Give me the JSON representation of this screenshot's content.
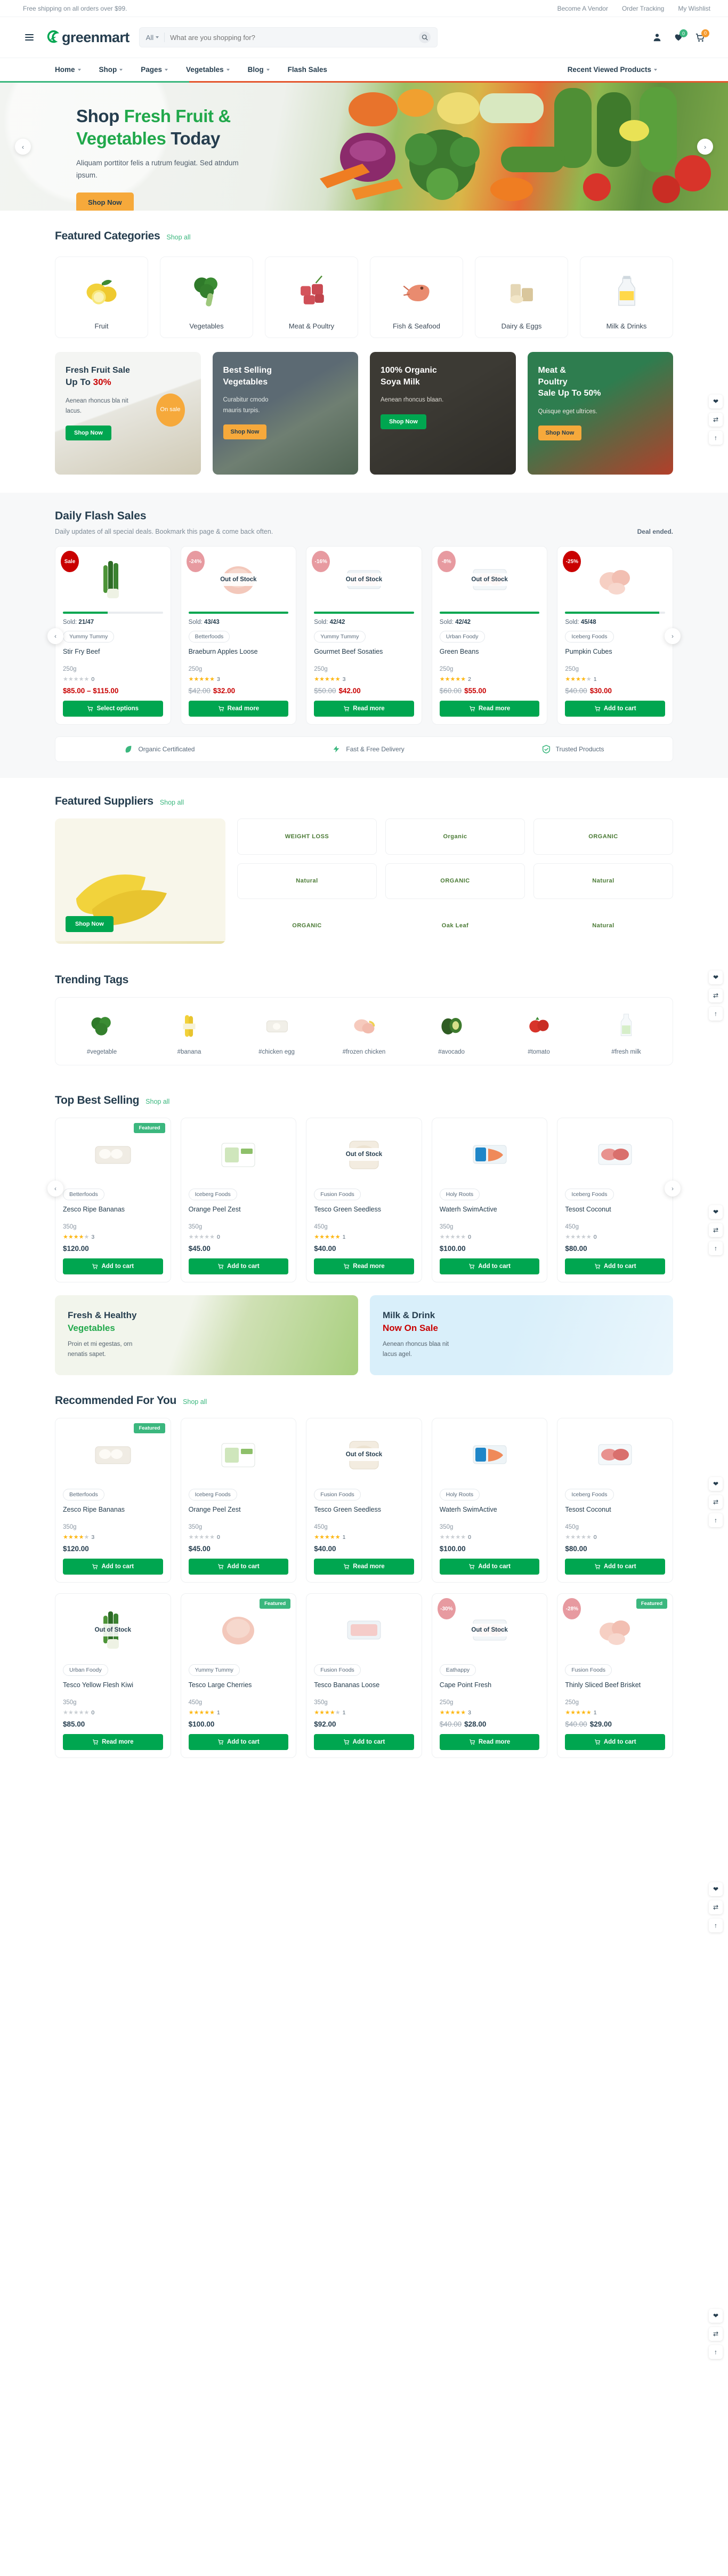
{
  "topbar": {
    "free_shipping": "Free shipping on all orders over $99.",
    "links": [
      "Become A Vendor",
      "Order Tracking",
      "My Wishlist"
    ]
  },
  "header": {
    "logo_text": "greenmart",
    "search": {
      "category": "All",
      "placeholder": "What are you shopping for?"
    },
    "cart_count": "0"
  },
  "nav": {
    "items": [
      {
        "label": "Home",
        "caret": true
      },
      {
        "label": "Shop",
        "caret": true
      },
      {
        "label": "Pages",
        "caret": true
      },
      {
        "label": "Vegetables",
        "caret": true
      },
      {
        "label": "Blog",
        "caret": true
      },
      {
        "label": "Flash Sales",
        "caret": false
      }
    ],
    "right": {
      "label": "Recent Viewed Products",
      "caret": true
    }
  },
  "hero": {
    "title_1": "Shop ",
    "title_green_1": "Fresh Fruit &",
    "title_green_2": "Vegetables",
    "title_2": " Today",
    "subtitle": "Aliquam porttitor felis a rutrum feugiat. Sed atndum ipsum.",
    "cta": "Shop Now",
    "prev": "‹",
    "next": "›"
  },
  "featured_categories": {
    "title": "Featured Categories",
    "shop_all": "Shop all",
    "items": [
      {
        "label": "Fruit",
        "icon": "lemon-icon"
      },
      {
        "label": "Vegetables",
        "icon": "broccoli-icon"
      },
      {
        "label": "Meat & Poultry",
        "icon": "meat-icon"
      },
      {
        "label": "Fish & Seafood",
        "icon": "shrimp-icon"
      },
      {
        "label": "Dairy & Eggs",
        "icon": "dairy-icon"
      },
      {
        "label": "Milk & Drinks",
        "icon": "milk-icon"
      }
    ]
  },
  "promos": [
    {
      "title_line1": "Fresh Fruit Sale",
      "title_line2": "Up To ",
      "highlight": "30%",
      "desc": "Aenean rhoncus bla nit lacus.",
      "cta": "Shop Now",
      "bubble": "On sale",
      "style": "p1",
      "btn": "green"
    },
    {
      "title_line1": "Best Selling",
      "title_line2": "Vegetables",
      "highlight": "",
      "desc": "Curabitur cmodo mauris turpis.",
      "cta": "Shop Now",
      "bubble": "",
      "style": "p2",
      "btn": "amber"
    },
    {
      "title_line1": "100% Organic",
      "title_line2": "Soya Milk",
      "highlight": "",
      "desc": "Aenean rhoncus blaan.",
      "cta": "Shop Now",
      "bubble": "",
      "style": "p3",
      "btn": "green"
    },
    {
      "title_line1": "Meat &",
      "title_line2": "Poultry",
      "title_line3": "Sale Up To",
      "highlight": "50%",
      "desc": "Quisque eget ultrices.",
      "cta": "Shop Now",
      "bubble": "",
      "style": "p4",
      "btn": "amber"
    }
  ],
  "flash_sales": {
    "title": "Daily Flash Sales",
    "subtitle": "Daily updates of all special deals. Bookmark this page & come back often.",
    "deal_status": "Deal ended.",
    "products": [
      {
        "badge": "Sale",
        "badge_type": "sale",
        "out_of_stock": false,
        "progress": 45,
        "sold": "Sold: ",
        "sold_val": "21/47",
        "vendor": "Yummy Tummy",
        "name": "Stir Fry Beef",
        "weight": "250g",
        "rating": 0,
        "rating_count": "0",
        "old_price": "",
        "price": "$85.00 – $115.00",
        "cta": "Select options"
      },
      {
        "badge": "-24%",
        "badge_type": "pct",
        "out_of_stock": true,
        "progress": 100,
        "sold": "Sold: ",
        "sold_val": "43/43",
        "vendor": "Betterfoods",
        "name": "Braeburn Apples Loose",
        "weight": "250g",
        "rating": 5,
        "rating_count": "3",
        "old_price": "$42.00",
        "price": "$32.00",
        "cta": "Read more"
      },
      {
        "badge": "-16%",
        "badge_type": "pct",
        "out_of_stock": true,
        "progress": 100,
        "sold": "Sold: ",
        "sold_val": "42/42",
        "vendor": "Yummy Tummy",
        "name": "Gourmet Beef Sosaties",
        "weight": "250g",
        "rating": 5,
        "rating_count": "3",
        "old_price": "$50.00",
        "price": "$42.00",
        "cta": "Read more"
      },
      {
        "badge": "-8%",
        "badge_type": "pct",
        "out_of_stock": true,
        "progress": 100,
        "sold": "Sold: ",
        "sold_val": "42/42",
        "vendor": "Urban Foody",
        "name": "Green Beans",
        "weight": "250g",
        "rating": 4.5,
        "rating_count": "2",
        "old_price": "$60.00",
        "price": "$55.00",
        "cta": "Read more"
      },
      {
        "badge": "-25%",
        "badge_type": "sale",
        "out_of_stock": false,
        "progress": 94,
        "sold": "Sold: ",
        "sold_val": "45/48",
        "vendor": "Iceberg Foods",
        "name": "Pumpkin Cubes",
        "weight": "250g",
        "rating": 4,
        "rating_count": "1",
        "old_price": "$40.00",
        "price": "$30.00",
        "cta": "Add to cart"
      }
    ],
    "trust": [
      {
        "label": "Organic Certificated",
        "icon": "leaf-icon"
      },
      {
        "label": "Fast & Free Delivery",
        "icon": "truck-icon"
      },
      {
        "label": "Trusted Products",
        "icon": "shield-icon"
      }
    ]
  },
  "suppliers": {
    "title": "Featured Suppliers",
    "shop_all": "Shop all",
    "banner_cta": "Shop Now",
    "logos": [
      "WEIGHT LOSS",
      "Organic",
      "ORGANIC",
      "Natural",
      "ORGANIC",
      "Natural",
      "ORGANIC",
      "Oak Leaf",
      "Natural"
    ]
  },
  "trending_tags": {
    "title": "Trending Tags",
    "items": [
      {
        "label": "#vegetable",
        "icon": "kale-icon"
      },
      {
        "label": "#banana",
        "icon": "banana-icon"
      },
      {
        "label": "#chicken egg",
        "icon": "egg-icon"
      },
      {
        "label": "#frozen chicken",
        "icon": "chicken-icon"
      },
      {
        "label": "#avocado",
        "icon": "avocado-icon"
      },
      {
        "label": "#tomato",
        "icon": "tomato-icon"
      },
      {
        "label": "#fresh milk",
        "icon": "milk-bottle-icon"
      }
    ]
  },
  "best_selling": {
    "title": "Top Best Selling",
    "shop_all": "Shop all",
    "products": [
      {
        "ribbon": "Featured",
        "out_of_stock": false,
        "vendor": "Betterfoods",
        "name": "Zesco Ripe Bananas",
        "weight": "350g",
        "rating": 4,
        "rating_count": "3",
        "price": "$120.00",
        "cta": "Add to cart",
        "img": "eggs"
      },
      {
        "ribbon": "",
        "out_of_stock": false,
        "vendor": "Iceberg Foods",
        "name": "Orange Peel Zest",
        "weight": "350g",
        "rating": 0,
        "rating_count": "0",
        "price": "$45.00",
        "cta": "Add to cart",
        "img": "freerange"
      },
      {
        "ribbon": "",
        "out_of_stock": true,
        "vendor": "Fusion Foods",
        "name": "Tesco Green Seedless",
        "weight": "450g",
        "rating": 5,
        "rating_count": "1",
        "price": "$40.00",
        "cta": "Read more",
        "img": "bag"
      },
      {
        "ribbon": "",
        "out_of_stock": false,
        "vendor": "Holy Roots",
        "name": "Waterh SwimActive",
        "weight": "350g",
        "rating": 0,
        "rating_count": "0",
        "price": "$100.00",
        "cta": "Add to cart",
        "img": "fish"
      },
      {
        "ribbon": "",
        "out_of_stock": false,
        "vendor": "Iceberg Foods",
        "name": "Tesost Coconut",
        "weight": "450g",
        "rating": 0,
        "rating_count": "0",
        "price": "$80.00",
        "cta": "Add to cart",
        "img": "fishpack"
      }
    ]
  },
  "mid_banners": [
    {
      "line1": "Fresh & Healthy",
      "line2": "Vegetables",
      "desc": "Proin et mi egestas, orn nenatis sapet.",
      "style": "m1"
    },
    {
      "line1": "Milk & Drink",
      "line2": "Now On Sale",
      "desc": "Aenean rhoncus blaa nit lacus agel.",
      "style": "m2",
      "red_line": true
    }
  ],
  "recommended": {
    "title": "Recommended For You",
    "shop_all": "Shop all",
    "row1": [
      {
        "ribbon": "Featured",
        "out_of_stock": false,
        "badge": "",
        "vendor": "Betterfoods",
        "name": "Zesco Ripe Bananas",
        "weight": "350g",
        "rating": 4,
        "rating_count": "3",
        "old_price": "",
        "price": "$120.00",
        "cta": "Add to cart"
      },
      {
        "ribbon": "",
        "out_of_stock": false,
        "badge": "",
        "vendor": "Iceberg Foods",
        "name": "Orange Peel Zest",
        "weight": "350g",
        "rating": 0,
        "rating_count": "0",
        "old_price": "",
        "price": "$45.00",
        "cta": "Add to cart"
      },
      {
        "ribbon": "",
        "out_of_stock": true,
        "badge": "",
        "vendor": "Fusion Foods",
        "name": "Tesco Green Seedless",
        "weight": "450g",
        "rating": 5,
        "rating_count": "1",
        "old_price": "",
        "price": "$40.00",
        "cta": "Read more"
      },
      {
        "ribbon": "",
        "out_of_stock": false,
        "badge": "",
        "vendor": "Holy Roots",
        "name": "Waterh SwimActive",
        "weight": "350g",
        "rating": 0,
        "rating_count": "0",
        "old_price": "",
        "price": "$100.00",
        "cta": "Add to cart"
      },
      {
        "ribbon": "",
        "out_of_stock": false,
        "badge": "",
        "vendor": "Iceberg Foods",
        "name": "Tesost Coconut",
        "weight": "450g",
        "rating": 0,
        "rating_count": "0",
        "old_price": "",
        "price": "$80.00",
        "cta": "Add to cart"
      }
    ],
    "row2": [
      {
        "ribbon": "",
        "out_of_stock": true,
        "badge": "",
        "vendor": "Urban Foody",
        "name": "Tesco Yellow Flesh Kiwi",
        "weight": "350g",
        "rating": 0,
        "rating_count": "0",
        "old_price": "",
        "price": "$85.00",
        "cta": "Read more"
      },
      {
        "ribbon": "Featured",
        "out_of_stock": false,
        "badge": "",
        "vendor": "Yummy Tummy",
        "name": "Tesco Large Cherries",
        "weight": "450g",
        "rating": 5,
        "rating_count": "1",
        "old_price": "",
        "price": "$100.00",
        "cta": "Add to cart"
      },
      {
        "ribbon": "",
        "out_of_stock": false,
        "badge": "",
        "vendor": "Fusion Foods",
        "name": "Tesco Bananas Loose",
        "weight": "350g",
        "rating": 4,
        "rating_count": "1",
        "old_price": "",
        "price": "$92.00",
        "cta": "Add to cart"
      },
      {
        "ribbon": "",
        "out_of_stock": true,
        "badge": "-30%",
        "vendor": "Eathappy",
        "name": "Cape Point Fresh",
        "weight": "250g",
        "rating": 5,
        "rating_count": "3",
        "old_price": "$40.00",
        "price": "$28.00",
        "cta": "Read more"
      },
      {
        "ribbon": "Featured",
        "out_of_stock": false,
        "badge": "-28%",
        "vendor": "Fusion Foods",
        "name": "Thinly Sliced Beef Brisket",
        "weight": "250g",
        "rating": 5,
        "rating_count": "1",
        "old_price": "$40.00",
        "price": "$29.00",
        "cta": "Add to cart"
      }
    ]
  },
  "colors": {
    "brand_green": "#3bb77e",
    "btn_green": "#00a650",
    "amber": "#f6a93b",
    "sale_red": "#c90000"
  }
}
